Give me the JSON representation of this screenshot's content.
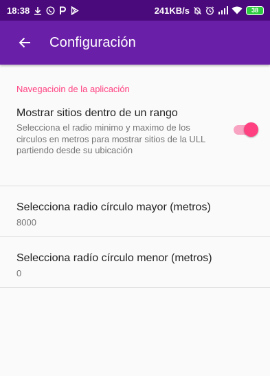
{
  "status_bar": {
    "time": "18:38",
    "net_speed": "241KB/s",
    "battery": "38",
    "left_icons": [
      "download-icon",
      "whatsapp-icon",
      "p-app-icon",
      "play-store-icon"
    ],
    "right_icons": [
      "silent-icon",
      "alarm-icon",
      "signal-icon",
      "wifi-icon",
      "battery-icon"
    ]
  },
  "app_bar": {
    "title": "Configuración",
    "background_color": "#6a1fa8",
    "status_color": "#4b0a7c"
  },
  "settings": {
    "category": "Navegacioin de la aplicación",
    "accent_color": "#ff4081",
    "range_pref": {
      "title": "Mostrar sitios dentro de un rango",
      "summary": "Selecciona el radio minimo y maximo de los circulos en metros para mostrar sitios de la ULL partiendo desde su ubicación",
      "enabled": true
    },
    "max_radius": {
      "title": "Selecciona radio círculo mayor (metros)",
      "value": "8000"
    },
    "min_radius": {
      "title": "Selecciona radío círculo menor (metros)",
      "value": "0"
    }
  }
}
